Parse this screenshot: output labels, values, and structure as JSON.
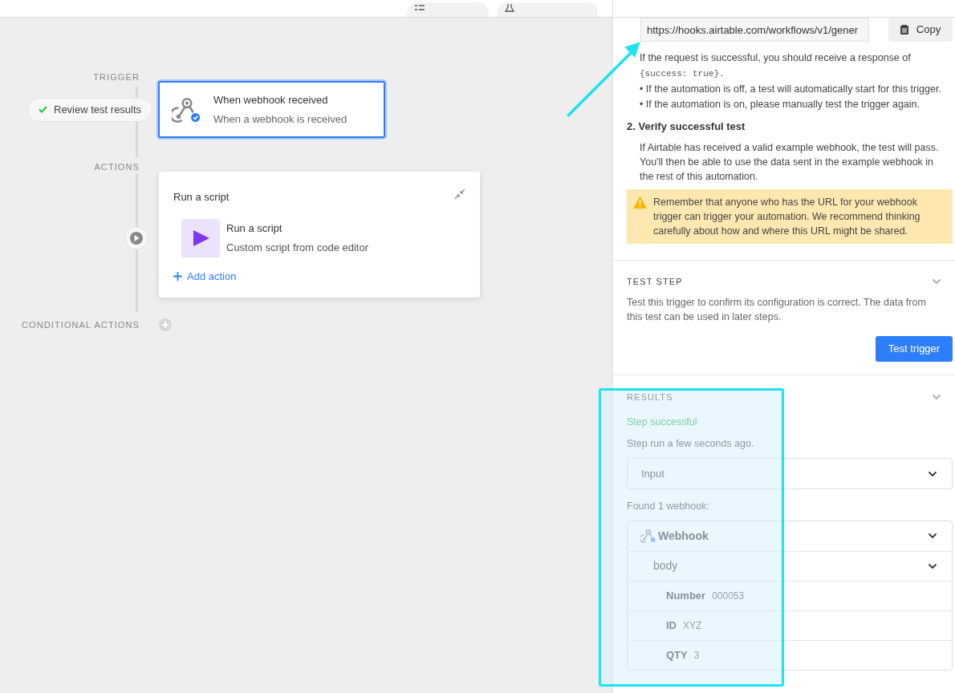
{
  "toolbar": {
    "buttons": [
      {
        "kind": "history"
      },
      {
        "kind": "flask"
      }
    ]
  },
  "canvas": {
    "trigger": {
      "section_label": "TRIGGER",
      "status": "Review test results",
      "title": "When webhook received",
      "subtitle": "When a webhook is received",
      "selected": true
    },
    "actions": {
      "section_label": "ACTIONS",
      "card_title": "Run a script",
      "step": {
        "title": "Run a script",
        "subtitle": "Custom script from code editor"
      },
      "add_label": "Add action"
    },
    "conditional": {
      "section_label": "CONDITIONAL ACTIONS"
    }
  },
  "panel": {
    "url": "https://hooks.airtable.com/workflows/v1/gener",
    "copy": "Copy",
    "response_text": "If the request is successful, you should receive a response of",
    "response_code": "{success: true}.",
    "bullets": [
      "• If the automation is off, a test will automatically start for this trigger.",
      "• If the automation is on, please manually test the trigger again."
    ],
    "step2_title": "2. Verify successful test",
    "step2_text": "If Airtable has received a valid example webhook, the test will pass. You'll then be able to use the data sent in the example webhook in the rest of this automation.",
    "warning": "Remember that anyone who has the URL for your webhook trigger can trigger your automation. We recommend thinking carefully about how and where this URL might be shared.",
    "test_step": {
      "heading": "TEST STEP",
      "expanded": true,
      "description": "Test this trigger to confirm its configuration is correct. The data from this test can be used in later steps.",
      "button": "Test trigger"
    },
    "results": {
      "heading": "RESULTS",
      "expanded": true,
      "status": "Step successful",
      "time": "Step run a few seconds ago.",
      "select": "Input",
      "found": "Found 1 webhook:",
      "tree": [
        {
          "label": "Webhook",
          "kind": "webhook",
          "expanded": true,
          "children": [
            {
              "label": "body",
              "kind": "object",
              "expanded": true,
              "children": [
                {
                  "label": "Number",
                  "value": "000053",
                  "kind": "field"
                },
                {
                  "label": "ID",
                  "value": "XYZ",
                  "kind": "field"
                },
                {
                  "label": "QTY",
                  "value": "3",
                  "kind": "field"
                }
              ]
            }
          ]
        }
      ]
    }
  },
  "annotations": {
    "arrow": {
      "color": "#1ee3f0"
    },
    "highlight": {
      "color": "#1ee3f0"
    }
  }
}
